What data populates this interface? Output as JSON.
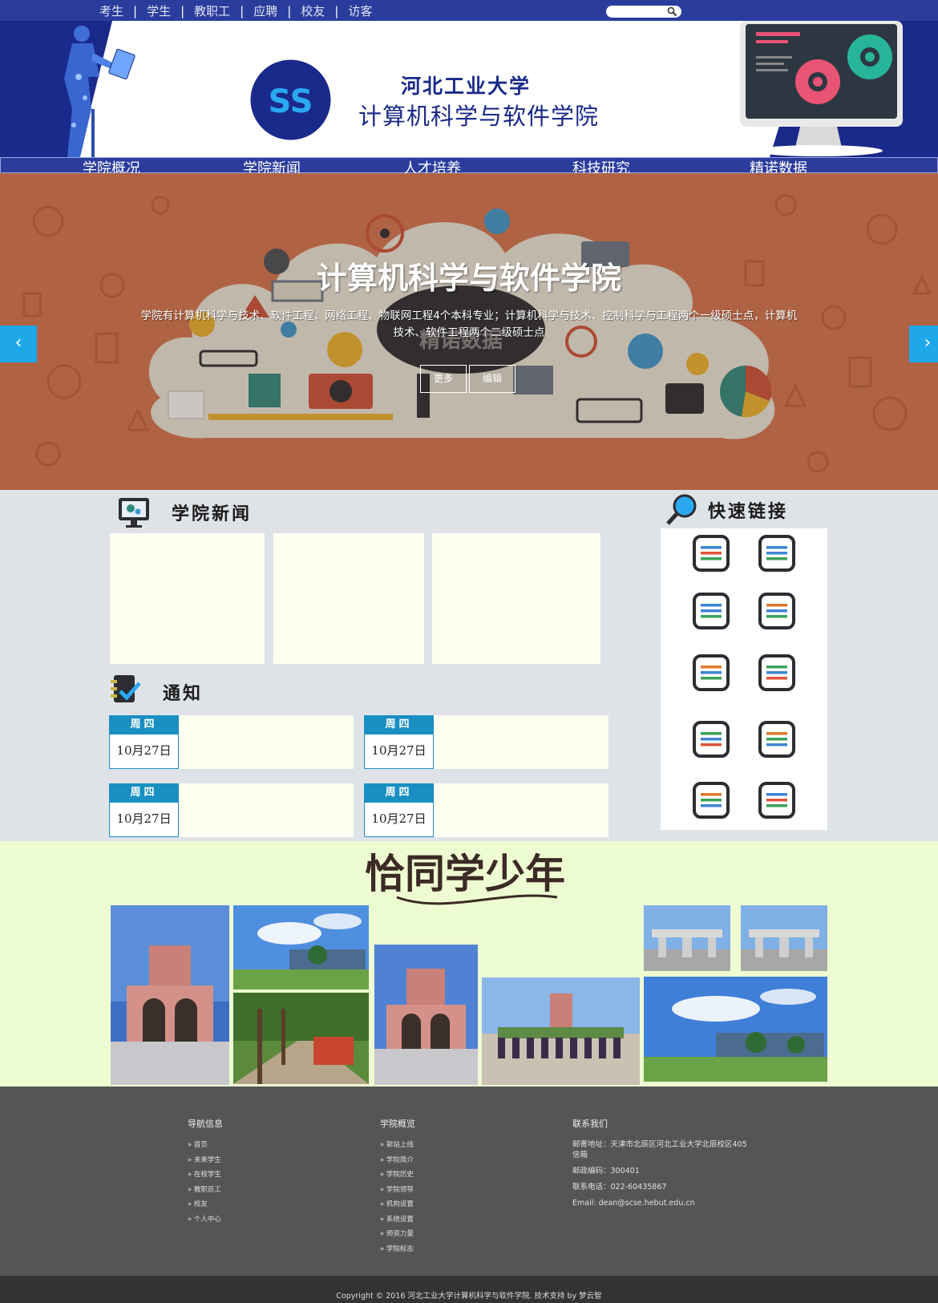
{
  "topbar": {
    "links": [
      "考生",
      "学生",
      "教职工",
      "应聘",
      "校友",
      "访客"
    ],
    "search_placeholder": ""
  },
  "header": {
    "logo_text": "SS",
    "school_name": "河北工业大学",
    "college_name": "计算机科学与软件学院"
  },
  "nav": {
    "items": [
      "学院概况",
      "学院新闻",
      "人才培养",
      "科技研究",
      "精诺数据"
    ]
  },
  "banner": {
    "title": "计算机科学与软件学院",
    "description": "学院有计算机科学与技术、软件工程、网络工程、物联网工程4个本科专业；计算机科学与技术、控制科学与工程两个一级硕士点，计算机技术、软件工程两个二级硕士点",
    "watermark": "精诺数据",
    "more_label": "更多",
    "edit_label": "编辑",
    "prev_icon": "‹",
    "next_icon": "›"
  },
  "news": {
    "title": "学院新闻",
    "icon": "monitor-gear-icon"
  },
  "notices": {
    "title": "通知",
    "icon": "notebook-check-icon",
    "items": [
      {
        "day": "周四",
        "date": "10月27日"
      },
      {
        "day": "周四",
        "date": "10月27日"
      },
      {
        "day": "周四",
        "date": "10月27日"
      },
      {
        "day": "周四",
        "date": "10月27日"
      }
    ]
  },
  "quicklinks": {
    "title": "快速链接",
    "icon": "magnifier-icon",
    "count": 10
  },
  "gallery": {
    "title": "恰同学少年"
  },
  "footer": {
    "nav_title": "导航信息",
    "nav_links": [
      "首页",
      "未来学生",
      "在校学生",
      "教职员工",
      "校友",
      "个人中心"
    ],
    "overview_title": "学院概览",
    "overview_links": [
      "新站上线",
      "学院简介",
      "学院历史",
      "学院领导",
      "机构设置",
      "系统设置",
      "师资力量",
      "学院标志"
    ],
    "contact_title": "联系我们",
    "address": "邮寄地址：天津市北辰区河北工业大学北辰校区405信箱",
    "postcode": "邮政编码：300401",
    "phone": "联系电话：022-60435867",
    "email": "Email: dean@scse.hebut.edu.cn",
    "copyright": "Copyright © 2016 河北工业大学计算机科学与软件学院. 技术支持 by 梦云智"
  },
  "colors": {
    "nav_blue": "#2b3d9c",
    "header_navy": "#1a2a8a",
    "accent_cyan": "#1ea8e8",
    "notice_blue": "#1a8fc2",
    "card_cream": "#fdfdf0",
    "gallery_bg": "#eefcd2",
    "footer_gray": "#555555"
  }
}
